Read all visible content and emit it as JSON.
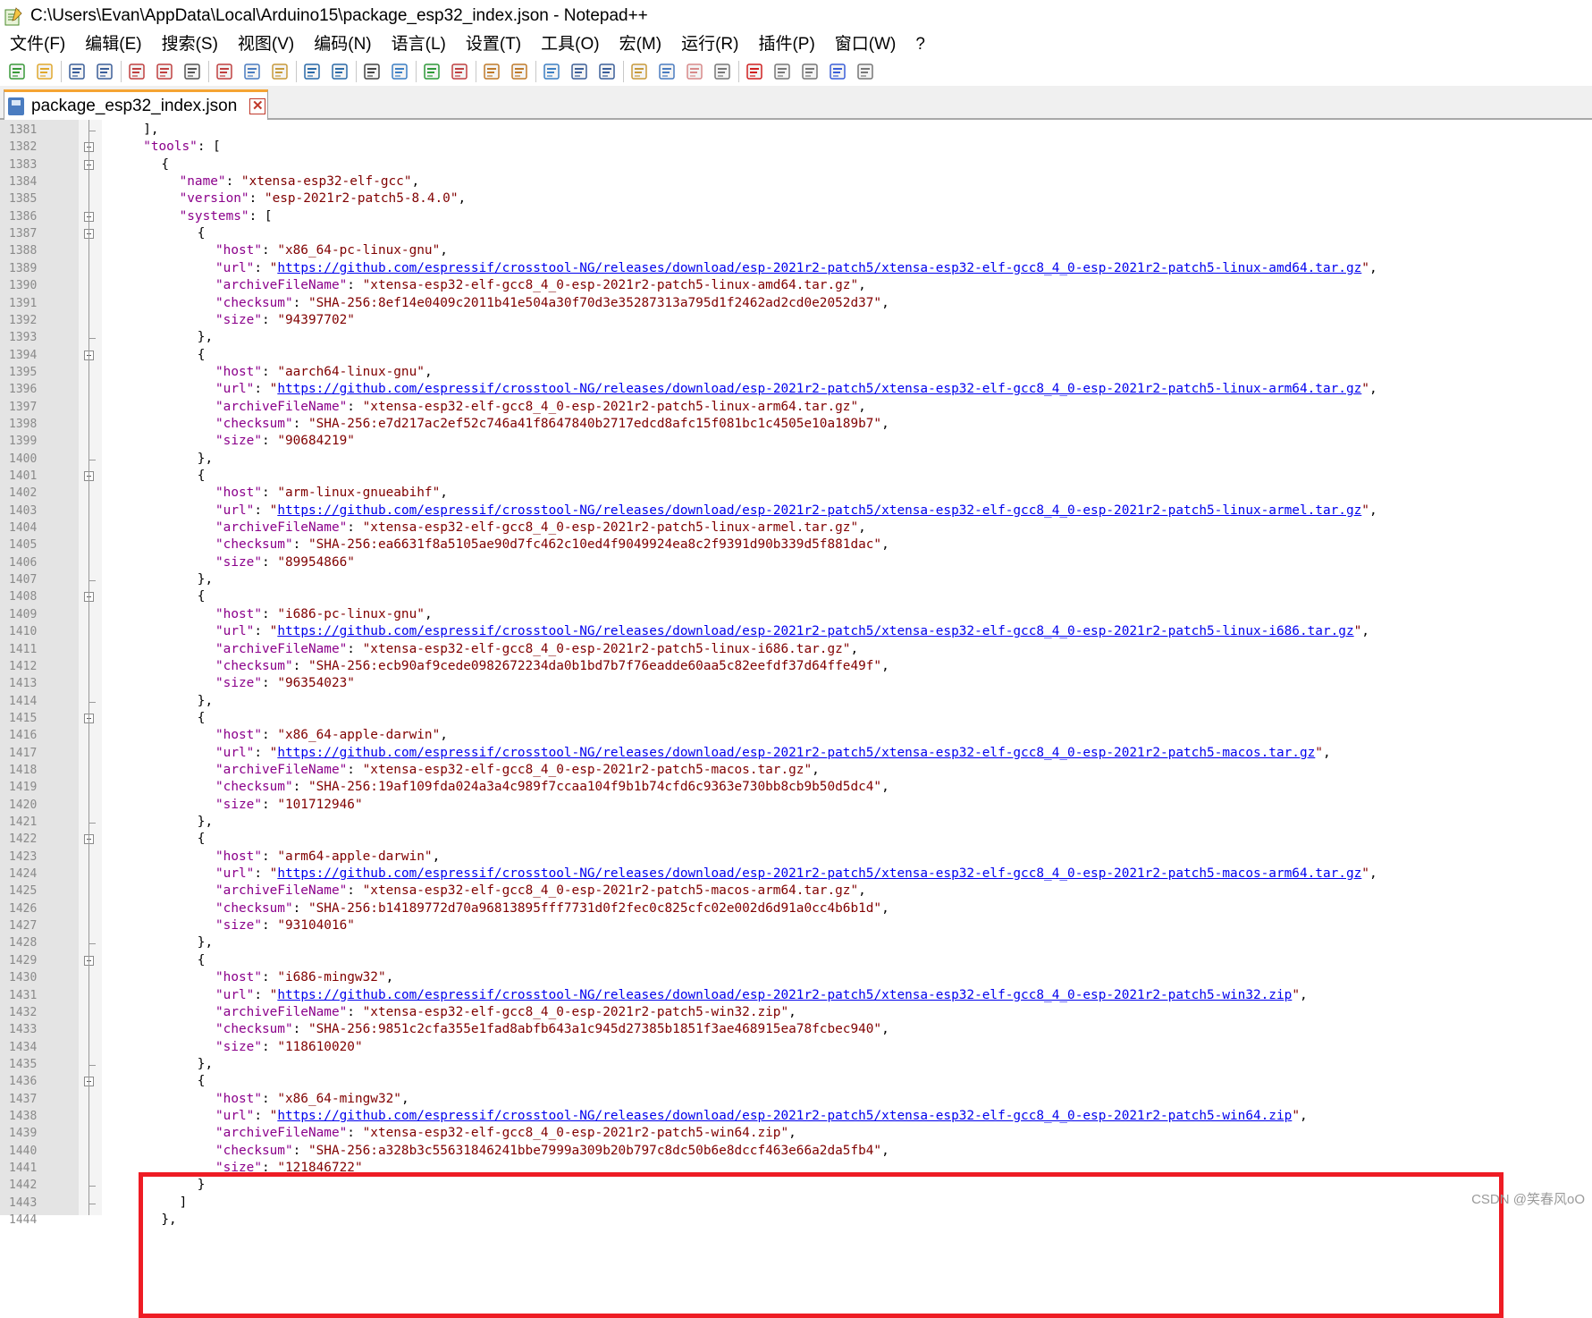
{
  "window": {
    "title": "C:\\Users\\Evan\\AppData\\Local\\Arduino15\\package_esp32_index.json - Notepad++"
  },
  "menu": [
    "文件(F)",
    "编辑(E)",
    "搜索(S)",
    "视图(V)",
    "编码(N)",
    "语言(L)",
    "设置(T)",
    "工具(O)",
    "宏(M)",
    "运行(R)",
    "插件(P)",
    "窗口(W)",
    "?"
  ],
  "toolbar": {
    "buttons": [
      "new-file",
      "open-file",
      "save",
      "save-all",
      "close",
      "close-all",
      "print",
      "cut",
      "copy",
      "paste",
      "undo",
      "redo",
      "find",
      "replace",
      "zoom-in",
      "zoom-out",
      "sync-vertical",
      "sync-horizontal",
      "word-wrap",
      "show-all-chars",
      "indent-guide",
      "function-list",
      "document-map",
      "folder-workspace",
      "monitoring",
      "record-macro",
      "stop-recording",
      "playback-macro",
      "run-macro-multiple",
      "save-macro"
    ]
  },
  "tab": {
    "label": "package_esp32_index.json",
    "close": "✕"
  },
  "editor": {
    "first_line": 1381,
    "lines": [
      [
        {
          "t": "p",
          "v": "],"
        }
      ],
      [
        {
          "t": "k",
          "v": "\"tools\""
        },
        {
          "t": "p",
          "v": ": ["
        }
      ],
      [
        {
          "t": "p",
          "v": "{"
        }
      ],
      [
        {
          "t": "k",
          "v": "\"name\""
        },
        {
          "t": "p",
          "v": ": "
        },
        {
          "t": "s",
          "v": "\"xtensa-esp32-elf-gcc\""
        },
        {
          "t": "p",
          "v": ","
        }
      ],
      [
        {
          "t": "k",
          "v": "\"version\""
        },
        {
          "t": "p",
          "v": ": "
        },
        {
          "t": "s",
          "v": "\"esp-2021r2-patch5-8.4.0\""
        },
        {
          "t": "p",
          "v": ","
        }
      ],
      [
        {
          "t": "k",
          "v": "\"systems\""
        },
        {
          "t": "p",
          "v": ": ["
        }
      ],
      [
        {
          "t": "p",
          "v": "{"
        }
      ],
      [
        {
          "t": "k",
          "v": "\"host\""
        },
        {
          "t": "p",
          "v": ": "
        },
        {
          "t": "s",
          "v": "\"x86_64-pc-linux-gnu\""
        },
        {
          "t": "p",
          "v": ","
        }
      ],
      [
        {
          "t": "k",
          "v": "\"url\""
        },
        {
          "t": "p",
          "v": ": "
        },
        {
          "t": "s",
          "v": "\""
        },
        {
          "t": "u",
          "v": "https://github.com/espressif/crosstool-NG/releases/download/esp-2021r2-patch5/xtensa-esp32-elf-gcc8_4_0-esp-2021r2-patch5-linux-amd64.tar.gz"
        },
        {
          "t": "s",
          "v": "\""
        },
        {
          "t": "p",
          "v": ","
        }
      ],
      [
        {
          "t": "k",
          "v": "\"archiveFileName\""
        },
        {
          "t": "p",
          "v": ": "
        },
        {
          "t": "s",
          "v": "\"xtensa-esp32-elf-gcc8_4_0-esp-2021r2-patch5-linux-amd64.tar.gz\""
        },
        {
          "t": "p",
          "v": ","
        }
      ],
      [
        {
          "t": "k",
          "v": "\"checksum\""
        },
        {
          "t": "p",
          "v": ": "
        },
        {
          "t": "s",
          "v": "\"SHA-256:8ef14e0409c2011b41e504a30f70d3e35287313a795d1f2462ad2cd0e2052d37\""
        },
        {
          "t": "p",
          "v": ","
        }
      ],
      [
        {
          "t": "k",
          "v": "\"size\""
        },
        {
          "t": "p",
          "v": ": "
        },
        {
          "t": "s",
          "v": "\"94397702\""
        }
      ],
      [
        {
          "t": "p",
          "v": "},"
        }
      ],
      [
        {
          "t": "p",
          "v": "{"
        }
      ],
      [
        {
          "t": "k",
          "v": "\"host\""
        },
        {
          "t": "p",
          "v": ": "
        },
        {
          "t": "s",
          "v": "\"aarch64-linux-gnu\""
        },
        {
          "t": "p",
          "v": ","
        }
      ],
      [
        {
          "t": "k",
          "v": "\"url\""
        },
        {
          "t": "p",
          "v": ": "
        },
        {
          "t": "s",
          "v": "\""
        },
        {
          "t": "u",
          "v": "https://github.com/espressif/crosstool-NG/releases/download/esp-2021r2-patch5/xtensa-esp32-elf-gcc8_4_0-esp-2021r2-patch5-linux-arm64.tar.gz"
        },
        {
          "t": "s",
          "v": "\""
        },
        {
          "t": "p",
          "v": ","
        }
      ],
      [
        {
          "t": "k",
          "v": "\"archiveFileName\""
        },
        {
          "t": "p",
          "v": ": "
        },
        {
          "t": "s",
          "v": "\"xtensa-esp32-elf-gcc8_4_0-esp-2021r2-patch5-linux-arm64.tar.gz\""
        },
        {
          "t": "p",
          "v": ","
        }
      ],
      [
        {
          "t": "k",
          "v": "\"checksum\""
        },
        {
          "t": "p",
          "v": ": "
        },
        {
          "t": "s",
          "v": "\"SHA-256:e7d217ac2ef52c746a41f8647840b2717edcd8afc15f081bc1c4505e10a189b7\""
        },
        {
          "t": "p",
          "v": ","
        }
      ],
      [
        {
          "t": "k",
          "v": "\"size\""
        },
        {
          "t": "p",
          "v": ": "
        },
        {
          "t": "s",
          "v": "\"90684219\""
        }
      ],
      [
        {
          "t": "p",
          "v": "},"
        }
      ],
      [
        {
          "t": "p",
          "v": "{"
        }
      ],
      [
        {
          "t": "k",
          "v": "\"host\""
        },
        {
          "t": "p",
          "v": ": "
        },
        {
          "t": "s",
          "v": "\"arm-linux-gnueabihf\""
        },
        {
          "t": "p",
          "v": ","
        }
      ],
      [
        {
          "t": "k",
          "v": "\"url\""
        },
        {
          "t": "p",
          "v": ": "
        },
        {
          "t": "s",
          "v": "\""
        },
        {
          "t": "u",
          "v": "https://github.com/espressif/crosstool-NG/releases/download/esp-2021r2-patch5/xtensa-esp32-elf-gcc8_4_0-esp-2021r2-patch5-linux-armel.tar.gz"
        },
        {
          "t": "s",
          "v": "\""
        },
        {
          "t": "p",
          "v": ","
        }
      ],
      [
        {
          "t": "k",
          "v": "\"archiveFileName\""
        },
        {
          "t": "p",
          "v": ": "
        },
        {
          "t": "s",
          "v": "\"xtensa-esp32-elf-gcc8_4_0-esp-2021r2-patch5-linux-armel.tar.gz\""
        },
        {
          "t": "p",
          "v": ","
        }
      ],
      [
        {
          "t": "k",
          "v": "\"checksum\""
        },
        {
          "t": "p",
          "v": ": "
        },
        {
          "t": "s",
          "v": "\"SHA-256:ea6631f8a5105ae90d7fc462c10ed4f9049924ea8c2f9391d90b339d5f881dac\""
        },
        {
          "t": "p",
          "v": ","
        }
      ],
      [
        {
          "t": "k",
          "v": "\"size\""
        },
        {
          "t": "p",
          "v": ": "
        },
        {
          "t": "s",
          "v": "\"89954866\""
        }
      ],
      [
        {
          "t": "p",
          "v": "},"
        }
      ],
      [
        {
          "t": "p",
          "v": "{"
        }
      ],
      [
        {
          "t": "k",
          "v": "\"host\""
        },
        {
          "t": "p",
          "v": ": "
        },
        {
          "t": "s",
          "v": "\"i686-pc-linux-gnu\""
        },
        {
          "t": "p",
          "v": ","
        }
      ],
      [
        {
          "t": "k",
          "v": "\"url\""
        },
        {
          "t": "p",
          "v": ": "
        },
        {
          "t": "s",
          "v": "\""
        },
        {
          "t": "u",
          "v": "https://github.com/espressif/crosstool-NG/releases/download/esp-2021r2-patch5/xtensa-esp32-elf-gcc8_4_0-esp-2021r2-patch5-linux-i686.tar.gz"
        },
        {
          "t": "s",
          "v": "\""
        },
        {
          "t": "p",
          "v": ","
        }
      ],
      [
        {
          "t": "k",
          "v": "\"archiveFileName\""
        },
        {
          "t": "p",
          "v": ": "
        },
        {
          "t": "s",
          "v": "\"xtensa-esp32-elf-gcc8_4_0-esp-2021r2-patch5-linux-i686.tar.gz\""
        },
        {
          "t": "p",
          "v": ","
        }
      ],
      [
        {
          "t": "k",
          "v": "\"checksum\""
        },
        {
          "t": "p",
          "v": ": "
        },
        {
          "t": "s",
          "v": "\"SHA-256:ecb90af9cede0982672234da0b1bd7b7f76eadde60aa5c82eefdf37d64ffe49f\""
        },
        {
          "t": "p",
          "v": ","
        }
      ],
      [
        {
          "t": "k",
          "v": "\"size\""
        },
        {
          "t": "p",
          "v": ": "
        },
        {
          "t": "s",
          "v": "\"96354023\""
        }
      ],
      [
        {
          "t": "p",
          "v": "},"
        }
      ],
      [
        {
          "t": "p",
          "v": "{"
        }
      ],
      [
        {
          "t": "k",
          "v": "\"host\""
        },
        {
          "t": "p",
          "v": ": "
        },
        {
          "t": "s",
          "v": "\"x86_64-apple-darwin\""
        },
        {
          "t": "p",
          "v": ","
        }
      ],
      [
        {
          "t": "k",
          "v": "\"url\""
        },
        {
          "t": "p",
          "v": ": "
        },
        {
          "t": "s",
          "v": "\""
        },
        {
          "t": "u",
          "v": "https://github.com/espressif/crosstool-NG/releases/download/esp-2021r2-patch5/xtensa-esp32-elf-gcc8_4_0-esp-2021r2-patch5-macos.tar.gz"
        },
        {
          "t": "s",
          "v": "\""
        },
        {
          "t": "p",
          "v": ","
        }
      ],
      [
        {
          "t": "k",
          "v": "\"archiveFileName\""
        },
        {
          "t": "p",
          "v": ": "
        },
        {
          "t": "s",
          "v": "\"xtensa-esp32-elf-gcc8_4_0-esp-2021r2-patch5-macos.tar.gz\""
        },
        {
          "t": "p",
          "v": ","
        }
      ],
      [
        {
          "t": "k",
          "v": "\"checksum\""
        },
        {
          "t": "p",
          "v": ": "
        },
        {
          "t": "s",
          "v": "\"SHA-256:19af109fda024a3a4c989f7ccaa104f9b1b74cfd6c9363e730bb8cb9b50d5dc4\""
        },
        {
          "t": "p",
          "v": ","
        }
      ],
      [
        {
          "t": "k",
          "v": "\"size\""
        },
        {
          "t": "p",
          "v": ": "
        },
        {
          "t": "s",
          "v": "\"101712946\""
        }
      ],
      [
        {
          "t": "p",
          "v": "},"
        }
      ],
      [
        {
          "t": "p",
          "v": "{"
        }
      ],
      [
        {
          "t": "k",
          "v": "\"host\""
        },
        {
          "t": "p",
          "v": ": "
        },
        {
          "t": "s",
          "v": "\"arm64-apple-darwin\""
        },
        {
          "t": "p",
          "v": ","
        }
      ],
      [
        {
          "t": "k",
          "v": "\"url\""
        },
        {
          "t": "p",
          "v": ": "
        },
        {
          "t": "s",
          "v": "\""
        },
        {
          "t": "u",
          "v": "https://github.com/espressif/crosstool-NG/releases/download/esp-2021r2-patch5/xtensa-esp32-elf-gcc8_4_0-esp-2021r2-patch5-macos-arm64.tar.gz"
        },
        {
          "t": "s",
          "v": "\""
        },
        {
          "t": "p",
          "v": ","
        }
      ],
      [
        {
          "t": "k",
          "v": "\"archiveFileName\""
        },
        {
          "t": "p",
          "v": ": "
        },
        {
          "t": "s",
          "v": "\"xtensa-esp32-elf-gcc8_4_0-esp-2021r2-patch5-macos-arm64.tar.gz\""
        },
        {
          "t": "p",
          "v": ","
        }
      ],
      [
        {
          "t": "k",
          "v": "\"checksum\""
        },
        {
          "t": "p",
          "v": ": "
        },
        {
          "t": "s",
          "v": "\"SHA-256:b14189772d70a96813895fff7731d0f2fec0c825cfc02e002d6d91a0cc4b6b1d\""
        },
        {
          "t": "p",
          "v": ","
        }
      ],
      [
        {
          "t": "k",
          "v": "\"size\""
        },
        {
          "t": "p",
          "v": ": "
        },
        {
          "t": "s",
          "v": "\"93104016\""
        }
      ],
      [
        {
          "t": "p",
          "v": "},"
        }
      ],
      [
        {
          "t": "p",
          "v": "{"
        }
      ],
      [
        {
          "t": "k",
          "v": "\"host\""
        },
        {
          "t": "p",
          "v": ": "
        },
        {
          "t": "s",
          "v": "\"i686-mingw32\""
        },
        {
          "t": "p",
          "v": ","
        }
      ],
      [
        {
          "t": "k",
          "v": "\"url\""
        },
        {
          "t": "p",
          "v": ": "
        },
        {
          "t": "s",
          "v": "\""
        },
        {
          "t": "u",
          "v": "https://github.com/espressif/crosstool-NG/releases/download/esp-2021r2-patch5/xtensa-esp32-elf-gcc8_4_0-esp-2021r2-patch5-win32.zip"
        },
        {
          "t": "s",
          "v": "\""
        },
        {
          "t": "p",
          "v": ","
        }
      ],
      [
        {
          "t": "k",
          "v": "\"archiveFileName\""
        },
        {
          "t": "p",
          "v": ": "
        },
        {
          "t": "s",
          "v": "\"xtensa-esp32-elf-gcc8_4_0-esp-2021r2-patch5-win32.zip\""
        },
        {
          "t": "p",
          "v": ","
        }
      ],
      [
        {
          "t": "k",
          "v": "\"checksum\""
        },
        {
          "t": "p",
          "v": ": "
        },
        {
          "t": "s",
          "v": "\"SHA-256:9851c2cfa355e1fad8abfb643a1c945d27385b1851f3ae468915ea78fcbec940\""
        },
        {
          "t": "p",
          "v": ","
        }
      ],
      [
        {
          "t": "k",
          "v": "\"size\""
        },
        {
          "t": "p",
          "v": ": "
        },
        {
          "t": "s",
          "v": "\"118610020\""
        }
      ],
      [
        {
          "t": "p",
          "v": "},"
        }
      ],
      [
        {
          "t": "p",
          "v": "{"
        }
      ],
      [
        {
          "t": "k",
          "v": "\"host\""
        },
        {
          "t": "p",
          "v": ": "
        },
        {
          "t": "s",
          "v": "\"x86_64-mingw32\""
        },
        {
          "t": "p",
          "v": ","
        }
      ],
      [
        {
          "t": "k",
          "v": "\"url\""
        },
        {
          "t": "p",
          "v": ": "
        },
        {
          "t": "s",
          "v": "\""
        },
        {
          "t": "u",
          "v": "https://github.com/espressif/crosstool-NG/releases/download/esp-2021r2-patch5/xtensa-esp32-elf-gcc8_4_0-esp-2021r2-patch5-win64.zip"
        },
        {
          "t": "s",
          "v": "\""
        },
        {
          "t": "p",
          "v": ","
        }
      ],
      [
        {
          "t": "k",
          "v": "\"archiveFileName\""
        },
        {
          "t": "p",
          "v": ": "
        },
        {
          "t": "s",
          "v": "\"xtensa-esp32-elf-gcc8_4_0-esp-2021r2-patch5-win64.zip\""
        },
        {
          "t": "p",
          "v": ","
        }
      ],
      [
        {
          "t": "k",
          "v": "\"checksum\""
        },
        {
          "t": "p",
          "v": ": "
        },
        {
          "t": "s",
          "v": "\"SHA-256:a328b3c55631846241bbe7999a309b20b797c8dc50b6e8dccf463e66a2da5fb4\""
        },
        {
          "t": "p",
          "v": ","
        }
      ],
      [
        {
          "t": "k",
          "v": "\"size\""
        },
        {
          "t": "p",
          "v": ": "
        },
        {
          "t": "s",
          "v": "\"121846722\""
        }
      ],
      [
        {
          "t": "p",
          "v": "}"
        }
      ],
      [
        {
          "t": "p",
          "v": "]"
        }
      ],
      [
        {
          "t": "p",
          "v": "},"
        }
      ]
    ]
  },
  "highlight": {
    "color": "#ee1c24"
  },
  "watermark": "CSDN @笑春风oO",
  "colors": {
    "key": "#8b008b",
    "string": "#800000",
    "link": "#0000ee",
    "tab_accent": "#f5a433"
  }
}
